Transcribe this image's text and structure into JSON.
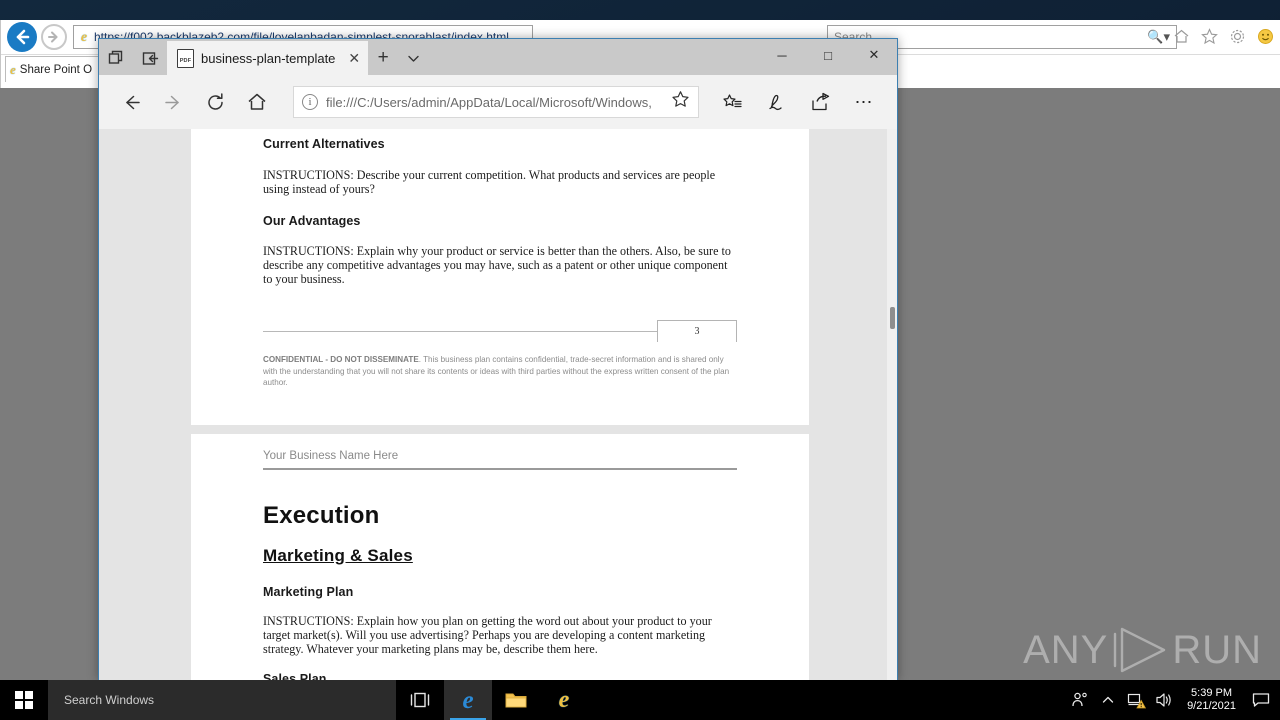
{
  "ie_window": {
    "address_url": "https://f002.backblazeb2.com/file/lovelanbadan-simplest-snorablast/index.html",
    "search_placeholder": "Search...",
    "tab_label": "Share Point O",
    "icons": {
      "back": "back-arrow-icon",
      "forward": "forward-arrow-icon",
      "favicon": "ie-favicon-icon",
      "magnifier": "search-magnifier-icon",
      "home": "home-icon",
      "favorites": "star-icon",
      "settings": "gear-icon",
      "smiley": "smiley-feedback-icon"
    }
  },
  "edge_window": {
    "tab": {
      "title": "business-plan-template",
      "favicon_label": "PDF",
      "close_label": "✕"
    },
    "titlebar_icons": {
      "tab_preview": "tab-preview-icon",
      "set_aside": "set-tabs-aside-icon",
      "new_tab": "+",
      "tab_menu": "⌄"
    },
    "window_controls": {
      "minimize": "─",
      "maximize": "□",
      "close": "✕"
    },
    "toolbar": {
      "back": "back-arrow-icon",
      "forward": "forward-arrow-icon",
      "refresh": "refresh-icon",
      "home": "home-icon",
      "url": "file:///C:/Users/admin/AppData/Local/Microsoft/Windows,",
      "info_glyph": "i",
      "favorite_star": "star-icon",
      "reading_list": "reading-list-icon",
      "notes": "notes-pen-icon",
      "share": "share-icon",
      "more": "⋯"
    }
  },
  "document": {
    "page1": {
      "sections": [
        {
          "heading": "Current Alternatives",
          "body": "INSTRUCTIONS: Describe your current competition. What products and services are people using instead of yours?"
        },
        {
          "heading": "Our Advantages",
          "body": "INSTRUCTIONS: Explain why your product or service is better than the others. Also, be sure to describe any competitive advantages you may have, such as a patent or other unique component to your business."
        }
      ],
      "page_number": "3",
      "confidential_lead": "CONFIDENTIAL - DO NOT DISSEMINATE",
      "confidential_body": ". This business plan contains confidential, trade-secret information and is shared only with the understanding that you will not share its contents or ideas with third parties without the express written consent of the plan author."
    },
    "page2": {
      "business_name": "Your Business Name Here",
      "title": "Execution",
      "subtitle": "Marketing & Sales",
      "sections": [
        {
          "heading": "Marketing Plan",
          "body": "INSTRUCTIONS: Explain how you plan on getting the word out about your product to your target market(s). Will you use advertising? Perhaps you are developing a content marketing strategy. Whatever your marketing plans may be, describe them here."
        },
        {
          "heading": "Sales Plan",
          "body": ""
        }
      ]
    }
  },
  "watermark": {
    "left": "ANY",
    "right": "RUN"
  },
  "taskbar": {
    "search_placeholder": "Search Windows",
    "start": "windows-start-icon",
    "task_view": "task-view-icon",
    "apps": [
      "edge-icon",
      "file-explorer-icon",
      "internet-explorer-icon"
    ],
    "tray": {
      "people": "people-icon",
      "chevron": "∧",
      "network": "network-warning-icon",
      "volume": "volume-icon",
      "time": "5:39 PM",
      "date": "9/21/2021",
      "action_center": "action-center-icon"
    }
  }
}
